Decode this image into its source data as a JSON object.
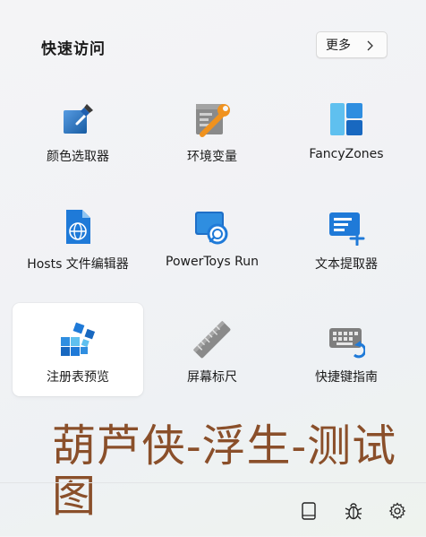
{
  "header": {
    "title": "快速访问",
    "more_label": "更多"
  },
  "tiles": [
    {
      "label": "颜色选取器",
      "icon": "color-picker-icon"
    },
    {
      "label": "环境变量",
      "icon": "environment-variables-icon"
    },
    {
      "label": "FancyZones",
      "icon": "fancyzones-icon"
    },
    {
      "label": "Hosts 文件编辑器",
      "icon": "hosts-file-editor-icon"
    },
    {
      "label": "PowerToys Run",
      "icon": "powertoys-run-icon"
    },
    {
      "label": "文本提取器",
      "icon": "text-extractor-icon"
    },
    {
      "label": "注册表预览",
      "icon": "registry-preview-icon"
    },
    {
      "label": "屏幕标尺",
      "icon": "screen-ruler-icon"
    },
    {
      "label": "快捷键指南",
      "icon": "shortcut-guide-icon"
    }
  ],
  "watermark": "葫芦侠-浮生-测试图",
  "footer": {
    "icons": [
      "document-icon",
      "bug-icon",
      "settings-icon"
    ]
  },
  "colors": {
    "accent_blue": "#1f7ad8",
    "orange": "#f0921e",
    "watermark": "#8a4f2a"
  }
}
